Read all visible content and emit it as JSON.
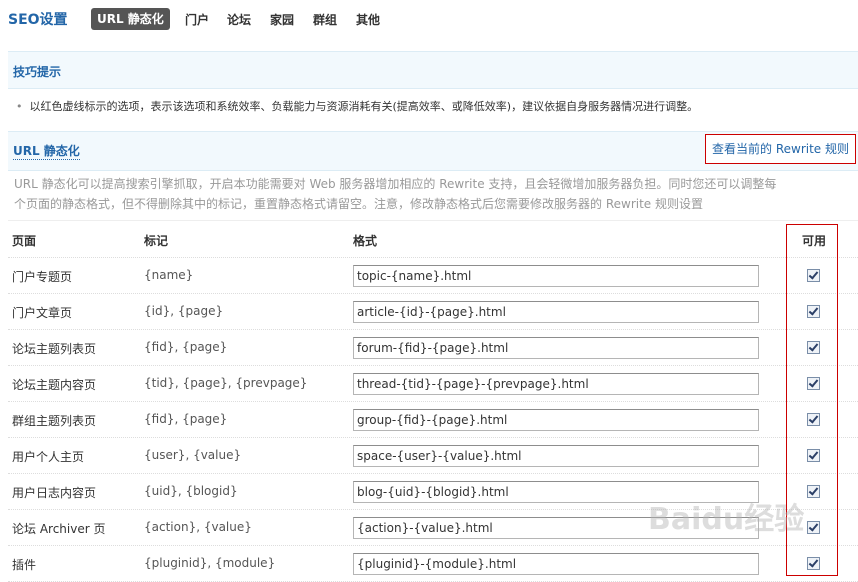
{
  "nav": {
    "title": "SEO设置",
    "tabs": [
      {
        "label": "URL 静态化",
        "active": true
      },
      {
        "label": "门户"
      },
      {
        "label": "论坛"
      },
      {
        "label": "家园"
      },
      {
        "label": "群组"
      },
      {
        "label": "其他"
      }
    ]
  },
  "tips": {
    "title": "技巧提示",
    "text": "以红色虚线标示的选项，表示该选项和系统效率、负载能力与资源消耗有关(提高效率、或降低效率)，建议依据自身服务器情况进行调整。"
  },
  "url_section": {
    "title": "URL 静态化",
    "rewrite_button": "查看当前的 Rewrite 规则",
    "desc_line1": "URL 静态化可以提高搜索引擎抓取，开启本功能需要对 Web 服务器增加相应的 Rewrite 支持，且会轻微增加服务器负担。同时您还可以调整每",
    "desc_line2": "个页面的静态格式，但不得删除其中的标记，重置静态格式请留空。注意，修改静态格式后您需要修改服务器的 Rewrite 规则设置"
  },
  "table": {
    "headers": {
      "page": "页面",
      "mark": "标记",
      "format": "格式",
      "available": "可用"
    },
    "rows": [
      {
        "page": "门户专题页",
        "mark": "{name}",
        "format": "topic-{name}.html",
        "enabled": true
      },
      {
        "page": "门户文章页",
        "mark": "{id}, {page}",
        "format": "article-{id}-{page}.html",
        "enabled": true
      },
      {
        "page": "论坛主题列表页",
        "mark": "{fid}, {page}",
        "format": "forum-{fid}-{page}.html",
        "enabled": true
      },
      {
        "page": "论坛主题内容页",
        "mark": "{tid}, {page}, {prevpage}",
        "format": "thread-{tid}-{page}-{prevpage}.html",
        "enabled": true
      },
      {
        "page": "群组主题列表页",
        "mark": "{fid}, {page}",
        "format": "group-{fid}-{page}.html",
        "enabled": true
      },
      {
        "page": "用户个人主页",
        "mark": "{user}, {value}",
        "format": "space-{user}-{value}.html",
        "enabled": true
      },
      {
        "page": "用户日志内容页",
        "mark": "{uid}, {blogid}",
        "format": "blog-{uid}-{blogid}.html",
        "enabled": true
      },
      {
        "page": "论坛 Archiver 页",
        "mark": "{action}, {value}",
        "format": "{action}-{value}.html",
        "enabled": true
      },
      {
        "page": "插件",
        "mark": "{pluginid}, {module}",
        "format": "{pluginid}-{module}.html",
        "enabled": true
      }
    ]
  },
  "watermark": "Baidu经验",
  "colors": {
    "accent": "#2366a8",
    "highlight_border": "#cc0000",
    "header_bg": "#f2f9fd"
  }
}
